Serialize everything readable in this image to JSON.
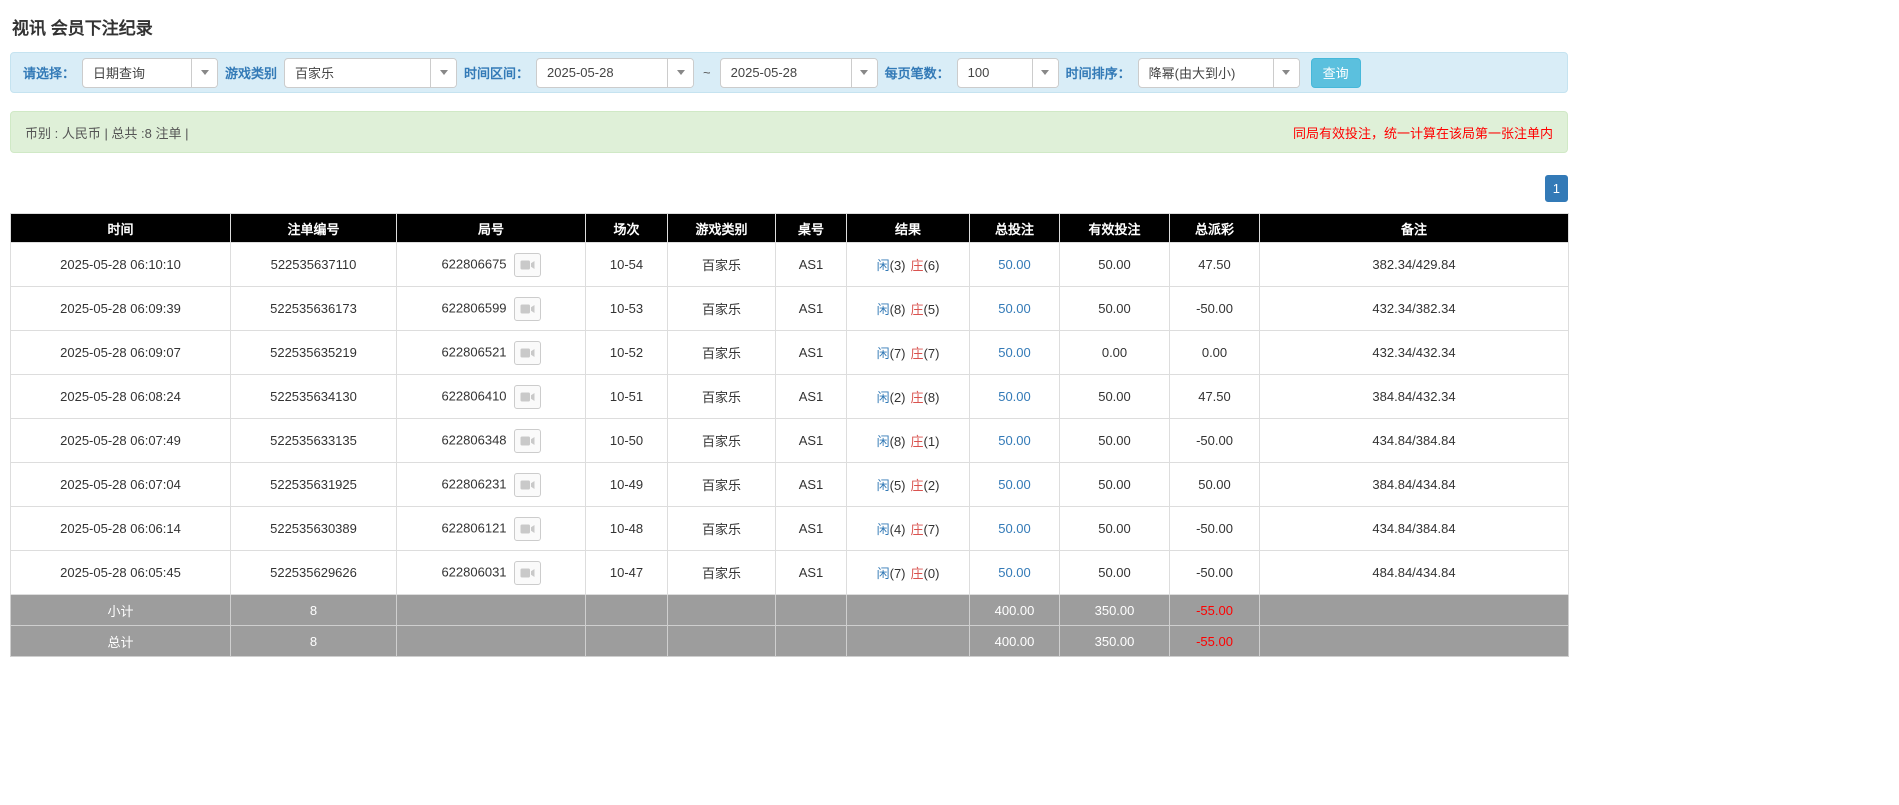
{
  "page": {
    "title": "视讯 会员下注纪录"
  },
  "filters": {
    "select_label": "请选择：",
    "select_value": "日期查询",
    "game_type_label": "游戏类别",
    "game_type_value": "百家乐",
    "time_range_label": "时间区间：",
    "date_from": "2025-05-28",
    "date_separator": "~",
    "date_to": "2025-05-28",
    "page_size_label": "每页笔数：",
    "page_size_value": "100",
    "sort_label": "时间排序：",
    "sort_value": "降幂(由大到小)",
    "search_button": "查询"
  },
  "summary": {
    "left_text": "币别 : 人民币 | 总共 :8 注单 |",
    "right_note": "同局有效投注，统一计算在该局第一张注单内"
  },
  "pagination": {
    "current_page": "1"
  },
  "table": {
    "headers": [
      "时间",
      "注单编号",
      "局号",
      "场次",
      "游戏类别",
      "桌号",
      "结果",
      "总投注",
      "有效投注",
      "总派彩",
      "备注"
    ],
    "rows": [
      {
        "time": "2025-05-28 06:10:10",
        "bet_no": "522535637110",
        "round_no": "622806675",
        "session": "10-54",
        "game": "百家乐",
        "table": "AS1",
        "player": "闲",
        "player_score": "(3)",
        "banker": "庄",
        "banker_score": "(6)",
        "total_bet": "50.00",
        "valid_bet": "50.00",
        "payout": "47.50",
        "remark": "382.34/429.84"
      },
      {
        "time": "2025-05-28 06:09:39",
        "bet_no": "522535636173",
        "round_no": "622806599",
        "session": "10-53",
        "game": "百家乐",
        "table": "AS1",
        "player": "闲",
        "player_score": "(8)",
        "banker": "庄",
        "banker_score": "(5)",
        "total_bet": "50.00",
        "valid_bet": "50.00",
        "payout": "-50.00",
        "remark": "432.34/382.34"
      },
      {
        "time": "2025-05-28 06:09:07",
        "bet_no": "522535635219",
        "round_no": "622806521",
        "session": "10-52",
        "game": "百家乐",
        "table": "AS1",
        "player": "闲",
        "player_score": "(7)",
        "banker": "庄",
        "banker_score": "(7)",
        "total_bet": "50.00",
        "valid_bet": "0.00",
        "payout": "0.00",
        "remark": "432.34/432.34"
      },
      {
        "time": "2025-05-28 06:08:24",
        "bet_no": "522535634130",
        "round_no": "622806410",
        "session": "10-51",
        "game": "百家乐",
        "table": "AS1",
        "player": "闲",
        "player_score": "(2)",
        "banker": "庄",
        "banker_score": "(8)",
        "total_bet": "50.00",
        "valid_bet": "50.00",
        "payout": "47.50",
        "remark": "384.84/432.34"
      },
      {
        "time": "2025-05-28 06:07:49",
        "bet_no": "522535633135",
        "round_no": "622806348",
        "session": "10-50",
        "game": "百家乐",
        "table": "AS1",
        "player": "闲",
        "player_score": "(8)",
        "banker": "庄",
        "banker_score": "(1)",
        "total_bet": "50.00",
        "valid_bet": "50.00",
        "payout": "-50.00",
        "remark": "434.84/384.84"
      },
      {
        "time": "2025-05-28 06:07:04",
        "bet_no": "522535631925",
        "round_no": "622806231",
        "session": "10-49",
        "game": "百家乐",
        "table": "AS1",
        "player": "闲",
        "player_score": "(5)",
        "banker": "庄",
        "banker_score": "(2)",
        "total_bet": "50.00",
        "valid_bet": "50.00",
        "payout": "50.00",
        "remark": "384.84/434.84"
      },
      {
        "time": "2025-05-28 06:06:14",
        "bet_no": "522535630389",
        "round_no": "622806121",
        "session": "10-48",
        "game": "百家乐",
        "table": "AS1",
        "player": "闲",
        "player_score": "(4)",
        "banker": "庄",
        "banker_score": "(7)",
        "total_bet": "50.00",
        "valid_bet": "50.00",
        "payout": "-50.00",
        "remark": "434.84/384.84"
      },
      {
        "time": "2025-05-28 06:05:45",
        "bet_no": "522535629626",
        "round_no": "622806031",
        "session": "10-47",
        "game": "百家乐",
        "table": "AS1",
        "player": "闲",
        "player_score": "(7)",
        "banker": "庄",
        "banker_score": "(0)",
        "total_bet": "50.00",
        "valid_bet": "50.00",
        "payout": "-50.00",
        "remark": "484.84/434.84"
      }
    ],
    "footer_rows": [
      {
        "label": "小计",
        "count": "8",
        "total_bet": "400.00",
        "valid_bet": "350.00",
        "payout": "-55.00",
        "remark": ""
      },
      {
        "label": "总计",
        "count": "8",
        "total_bet": "400.00",
        "valid_bet": "350.00",
        "payout": "-55.00",
        "remark": ""
      }
    ]
  },
  "colors": {
    "link_blue": "#337ab7",
    "player_blue": "#337ab7",
    "banker_red": "#d9534f",
    "negative_red": "#ff0000",
    "header_bg": "#000000",
    "footer_bg": "#9d9d9d",
    "filter_bar_bg": "#d9edf7",
    "summary_bar_bg": "#dff0d8",
    "search_button_bg": "#5bc0de",
    "pagination_bg": "#337ab7"
  }
}
